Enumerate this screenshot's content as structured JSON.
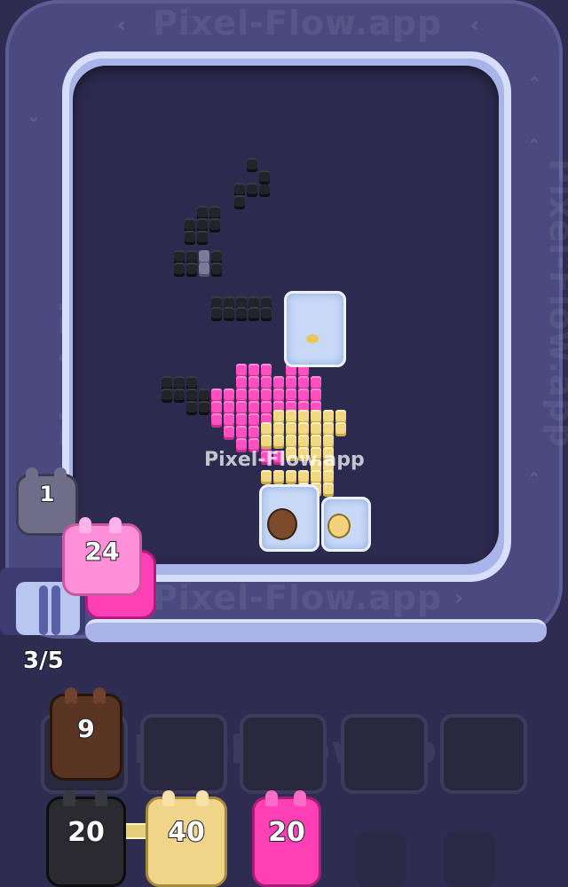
{
  "watermark": {
    "text": "Pixel-Flow.app",
    "center_text": "Pixel-Flow.app"
  },
  "queue_counter": "3/5",
  "conveyor_critters": [
    {
      "id": "grey-1",
      "color": "#6f6d88",
      "count": "1"
    },
    {
      "id": "pink-24",
      "color": "#ff8fd8",
      "count": "24"
    }
  ],
  "slots": [
    {
      "index": 1,
      "state": "occupied",
      "critter": {
        "color": "#5a3422",
        "count": "9"
      }
    },
    {
      "index": 2,
      "state": "empty"
    },
    {
      "index": 3,
      "state": "empty"
    },
    {
      "index": 4,
      "state": "empty"
    },
    {
      "index": 5,
      "state": "empty"
    }
  ],
  "waiting_critters": [
    {
      "id": "black-20",
      "color": "#2a2a30",
      "count": "20"
    },
    {
      "id": "yellow-40",
      "color": "#f0d48a",
      "count": "40"
    },
    {
      "id": "magenta-20",
      "color": "#ff3fb5",
      "count": "20"
    }
  ],
  "linked_pair": [
    "black-20",
    "yellow-40"
  ],
  "colors": {
    "background": "#2f2c52",
    "track": "#a9b4e8",
    "board": "#2d2a4f",
    "pink": "#ff4fc0",
    "yellow": "#f3d884",
    "black": "#23232a"
  }
}
